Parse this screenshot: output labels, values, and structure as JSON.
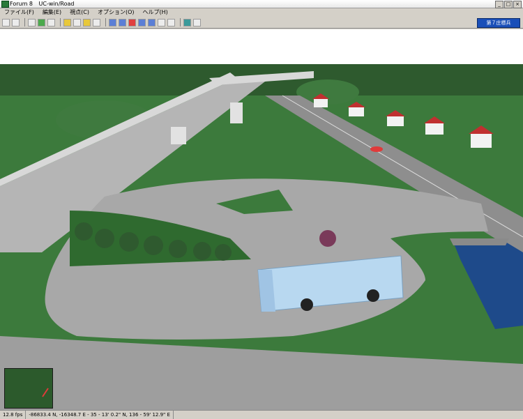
{
  "window": {
    "app_name": "Forum 8",
    "title": "UC-win/Road"
  },
  "menu": {
    "items": [
      "ファイル(F)",
      "編集(E)",
      "視点(C)",
      "オプション(O)",
      "ヘルプ(H)"
    ]
  },
  "toolbar": {
    "location_label": "第７庄標兵"
  },
  "status": {
    "fps": "12.8 fps",
    "coords": "-86833.4 N, -16348.7 E  -  35 - 13' 0.2\" N, 136 - 59' 12.9\" E"
  },
  "colors": {
    "sky": "#ffffff",
    "grass_dark": "#2e5a2e",
    "grass": "#3c7a3c",
    "road": "#a8a8a8",
    "water": "#1e4a8a",
    "bus": "#b8d8f0"
  }
}
